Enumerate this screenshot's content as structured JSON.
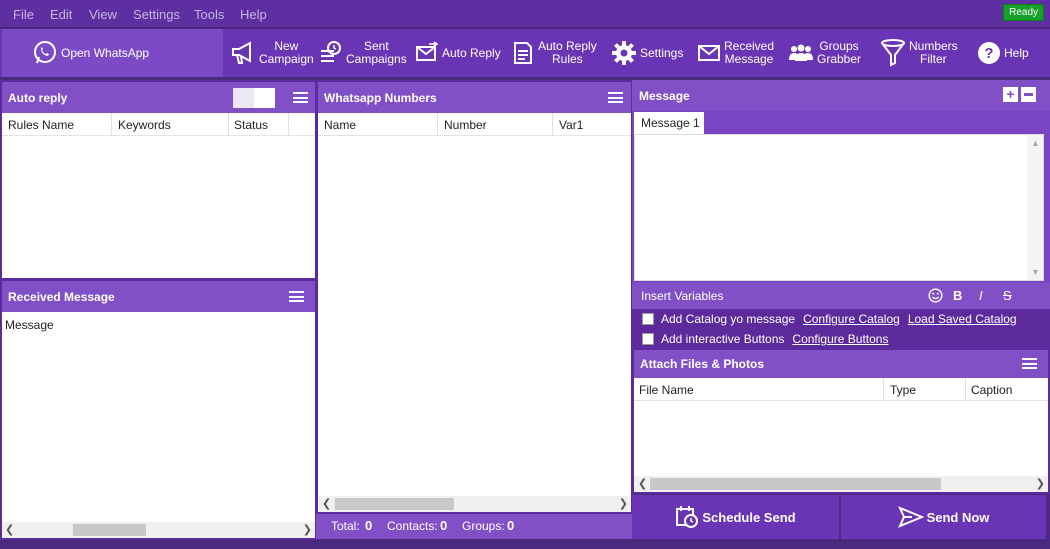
{
  "menu": {
    "file": "File",
    "edit": "Edit",
    "view": "View",
    "settings": "Settings",
    "tools": "Tools",
    "help": "Help"
  },
  "status": {
    "ready": "Ready"
  },
  "toolbar": {
    "open_whatsapp": "Open WhatsApp",
    "new_campaign_1": "New",
    "new_campaign_2": "Campaign",
    "sent_campaigns_1": "Sent",
    "sent_campaigns_2": "Campaigns",
    "auto_reply": "Auto Reply",
    "auto_reply_rules_1": "Auto Reply",
    "auto_reply_rules_2": "Rules",
    "settings": "Settings",
    "received_message_1": "Received",
    "received_message_2": "Message",
    "groups_grabber_1": "Groups",
    "groups_grabber_2": "Grabber",
    "numbers_filter_1": "Numbers",
    "numbers_filter_2": "Filter",
    "help": "Help"
  },
  "auto_reply_panel": {
    "title": "Auto reply",
    "columns": [
      "Rules Name",
      "Keywords",
      "Status"
    ]
  },
  "received_panel": {
    "title": "Received Message",
    "column": "Message"
  },
  "numbers_panel": {
    "title": "Whatsapp Numbers",
    "columns": [
      "Name",
      "Number",
      "Var1"
    ],
    "total_label": "Total:",
    "total_value": "0",
    "contacts_label": "Contacts:",
    "contacts_value": "0",
    "groups_label": "Groups:",
    "groups_value": "0"
  },
  "message_panel": {
    "title": "Message",
    "tab": "Message 1",
    "insert_variables": "Insert Variables",
    "bold": "B",
    "italic": "I",
    "strike": "S",
    "add_catalog": "Add Catalog yo message",
    "configure_catalog": "Configure Catalog",
    "load_saved_catalog": "Load Saved Catalog",
    "add_buttons": "Add interactive Buttons",
    "configure_buttons": "Configure Buttons"
  },
  "attach_panel": {
    "title": "Attach Files & Photos",
    "columns": [
      "File Name",
      "Type",
      "Caption"
    ]
  },
  "actions": {
    "schedule_send": "Schedule Send",
    "send_now": "Send Now"
  }
}
